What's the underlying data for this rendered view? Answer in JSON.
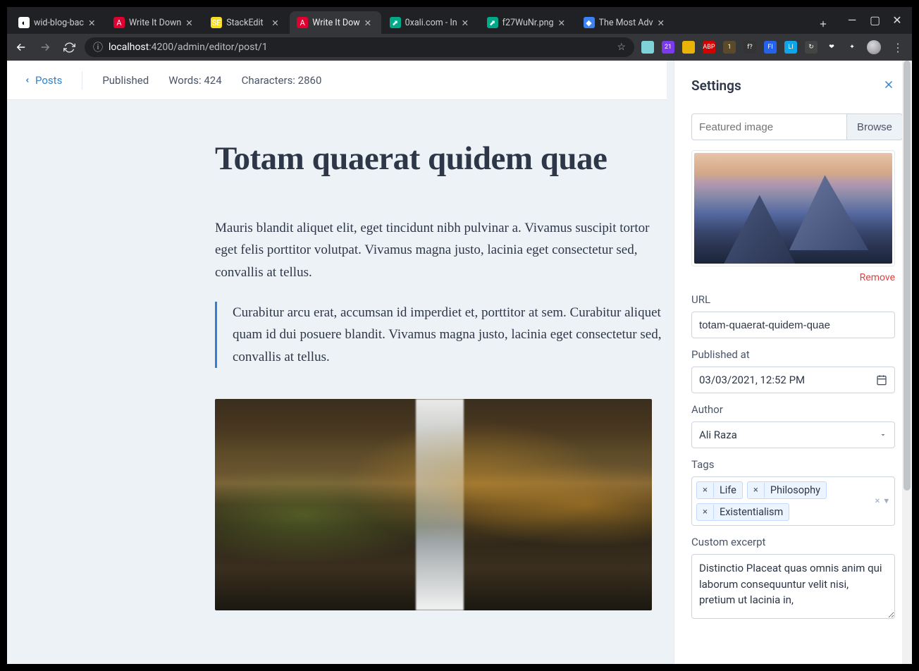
{
  "browser": {
    "tabs": [
      {
        "label": "wid-blog-bac",
        "fav": "gh"
      },
      {
        "label": "Write It Down",
        "fav": "A"
      },
      {
        "label": "StackEdit",
        "fav": "SE"
      },
      {
        "label": "Write It Dow",
        "fav": "A",
        "active": true
      },
      {
        "label": "0xali.com - In",
        "fav": "⬈"
      },
      {
        "label": "f27WuNr.png",
        "fav": "⬈"
      },
      {
        "label": "The Most Adv",
        "fav": "◆"
      }
    ],
    "url_info": "ⓘ",
    "url_host": "localhost",
    "url_path": ":4200/admin/editor/post/1",
    "extensions": [
      {
        "bg": "#7dd3d8",
        "t": ""
      },
      {
        "bg": "#7c3aed",
        "t": "21"
      },
      {
        "bg": "#eab308",
        "t": ""
      },
      {
        "bg": "#d30000",
        "t": "ABP"
      },
      {
        "bg": "#5a4a2a",
        "t": "1"
      },
      {
        "bg": "#333",
        "t": "f?"
      },
      {
        "bg": "#2563eb",
        "t": "FI"
      },
      {
        "bg": "#0ea5e9",
        "t": "LI"
      },
      {
        "bg": "#444",
        "t": "↻"
      },
      {
        "bg": "transparent",
        "t": "❤"
      },
      {
        "bg": "transparent",
        "t": "✦"
      }
    ]
  },
  "header": {
    "posts": "Posts",
    "status": "Published",
    "words": "Words: 424",
    "chars": "Characters: 2860"
  },
  "article": {
    "title": "Totam quaerat quidem quae",
    "p1": "Mauris blandit aliquet elit, eget tincidunt nibh pulvinar a. Vivamus suscipit tortor eget felis porttitor volutpat. Vivamus magna justo, lacinia eget consectetur sed, convallis at tellus.",
    "quote": "Curabitur arcu erat, accumsan id imperdiet et, porttitor at sem. Curabitur aliquet quam id dui posuere blandit. Vivamus magna justo, lacinia eget consectetur sed, convallis at tellus."
  },
  "settings": {
    "title": "Settings",
    "featured_placeholder": "Featured image",
    "browse": "Browse",
    "remove": "Remove",
    "url_label": "URL",
    "url_value": "totam-quaerat-quidem-quae",
    "published_label": "Published at",
    "published_value": "03/03/2021, 12:52 PM",
    "author_label": "Author",
    "author_value": "Ali Raza",
    "tags_label": "Tags",
    "tags": [
      "Life",
      "Philosophy",
      "Existentialism"
    ],
    "excerpt_label": "Custom excerpt",
    "excerpt_value": "Distinctio Placeat quas omnis anim qui laborum consequuntur velit nisi, pretium ut lacinia in,"
  }
}
